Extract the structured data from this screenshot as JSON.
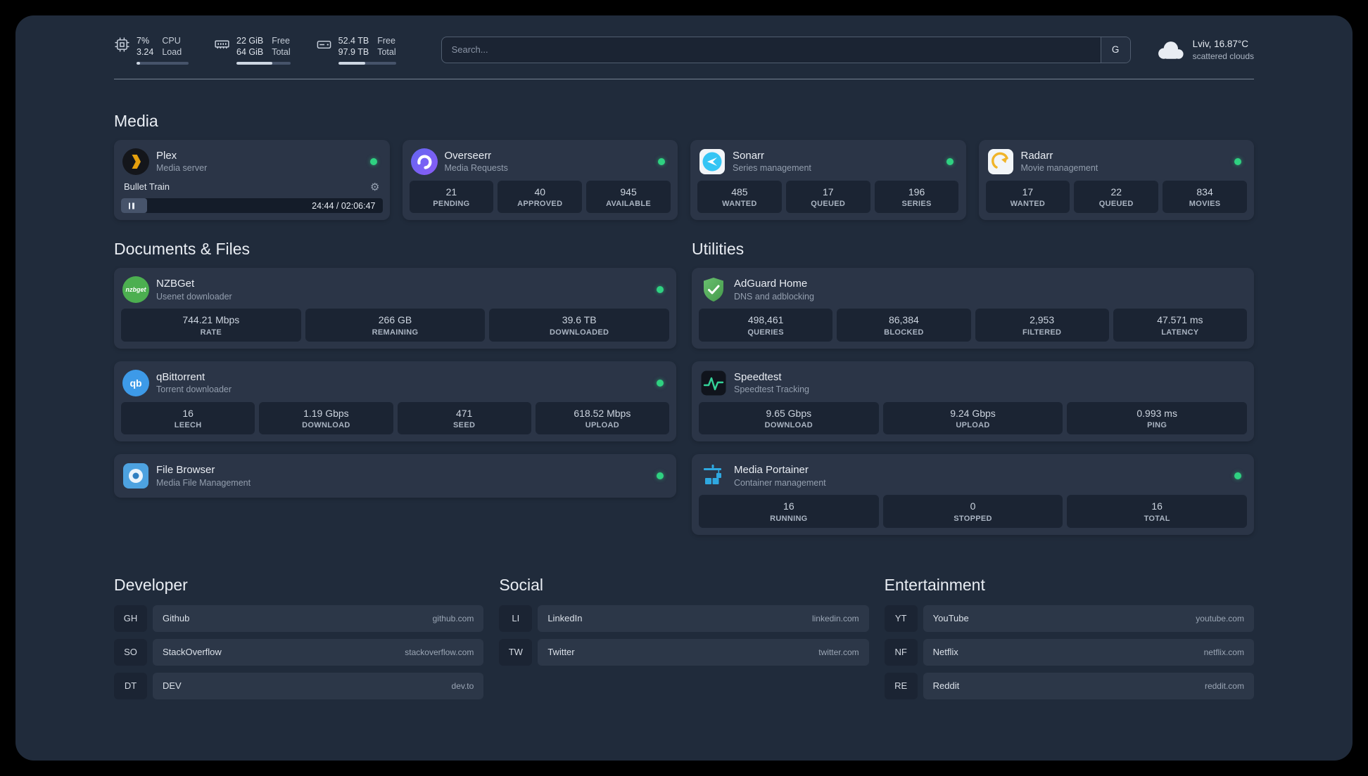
{
  "colors": {
    "status_online": "#2fd181",
    "plex_amber": "#e5a00d",
    "accent_green": "#34d399",
    "portainer_blue": "#2fa8e0"
  },
  "icons": {
    "gear": "⚙"
  },
  "topbar": {
    "cpu": {
      "percent": "7%",
      "load": "3.24",
      "label1": "CPU",
      "label2": "Load",
      "fill": 7
    },
    "memory": {
      "free": "22 GiB",
      "total": "64 GiB",
      "label1": "Free",
      "label2": "Total",
      "fill": 66
    },
    "disk": {
      "free": "52.4 TB",
      "total": "97.9 TB",
      "label1": "Free",
      "label2": "Total",
      "fill": 47
    },
    "search": {
      "placeholder": "Search...",
      "value": "",
      "button": "G"
    },
    "weather": {
      "location": "Lviv, 16.87°C",
      "condition": "scattered clouds"
    }
  },
  "media": {
    "heading": "Media",
    "plex": {
      "name": "Plex",
      "subtitle": "Media server",
      "online": true,
      "now_playing": "Bullet Train",
      "progress_time": "24:44 / 02:06:47",
      "progress_percent": 10
    },
    "overseerr": {
      "name": "Overseerr",
      "subtitle": "Media Requests",
      "online": true,
      "stats": [
        {
          "value": "21",
          "label": "PENDING"
        },
        {
          "value": "40",
          "label": "APPROVED"
        },
        {
          "value": "945",
          "label": "AVAILABLE"
        }
      ]
    },
    "sonarr": {
      "name": "Sonarr",
      "subtitle": "Series management",
      "online": true,
      "stats": [
        {
          "value": "485",
          "label": "WANTED"
        },
        {
          "value": "17",
          "label": "QUEUED"
        },
        {
          "value": "196",
          "label": "SERIES"
        }
      ]
    },
    "radarr": {
      "name": "Radarr",
      "subtitle": "Movie management",
      "online": true,
      "stats": [
        {
          "value": "17",
          "label": "WANTED"
        },
        {
          "value": "22",
          "label": "QUEUED"
        },
        {
          "value": "834",
          "label": "MOVIES"
        }
      ]
    }
  },
  "documents": {
    "heading": "Documents & Files",
    "nzbget": {
      "name": "NZBGet",
      "subtitle": "Usenet downloader",
      "online": true,
      "icon_text": "nzbget",
      "stats": [
        {
          "value": "744.21 Mbps",
          "label": "RATE"
        },
        {
          "value": "266 GB",
          "label": "REMAINING"
        },
        {
          "value": "39.6 TB",
          "label": "DOWNLOADED"
        }
      ]
    },
    "qbittorrent": {
      "name": "qBittorrent",
      "subtitle": "Torrent downloader",
      "online": true,
      "icon_text": "qb",
      "stats": [
        {
          "value": "16",
          "label": "LEECH"
        },
        {
          "value": "1.19 Gbps",
          "label": "DOWNLOAD"
        },
        {
          "value": "471",
          "label": "SEED"
        },
        {
          "value": "618.52 Mbps",
          "label": "UPLOAD"
        }
      ]
    },
    "filebrowser": {
      "name": "File Browser",
      "subtitle": "Media File Management",
      "online": true
    }
  },
  "utilities": {
    "heading": "Utilities",
    "adguard": {
      "name": "AdGuard Home",
      "subtitle": "DNS and adblocking",
      "stats": [
        {
          "value": "498,461",
          "label": "QUERIES"
        },
        {
          "value": "86,384",
          "label": "BLOCKED"
        },
        {
          "value": "2,953",
          "label": "FILTERED"
        },
        {
          "value": "47.571 ms",
          "label": "LATENCY"
        }
      ]
    },
    "speedtest": {
      "name": "Speedtest",
      "subtitle": "Speedtest Tracking",
      "stats": [
        {
          "value": "9.65 Gbps",
          "label": "DOWNLOAD"
        },
        {
          "value": "9.24 Gbps",
          "label": "UPLOAD"
        },
        {
          "value": "0.993 ms",
          "label": "PING"
        }
      ]
    },
    "portainer": {
      "name": "Media Portainer",
      "subtitle": "Container management",
      "online": true,
      "stats": [
        {
          "value": "16",
          "label": "RUNNING"
        },
        {
          "value": "0",
          "label": "STOPPED"
        },
        {
          "value": "16",
          "label": "TOTAL"
        }
      ]
    }
  },
  "bookmarks": {
    "developer": {
      "heading": "Developer",
      "items": [
        {
          "abbr": "GH",
          "name": "Github",
          "url": "github.com"
        },
        {
          "abbr": "SO",
          "name": "StackOverflow",
          "url": "stackoverflow.com"
        },
        {
          "abbr": "DT",
          "name": "DEV",
          "url": "dev.to"
        }
      ]
    },
    "social": {
      "heading": "Social",
      "items": [
        {
          "abbr": "LI",
          "name": "LinkedIn",
          "url": "linkedin.com"
        },
        {
          "abbr": "TW",
          "name": "Twitter",
          "url": "twitter.com"
        }
      ]
    },
    "entertainment": {
      "heading": "Entertainment",
      "items": [
        {
          "abbr": "YT",
          "name": "YouTube",
          "url": "youtube.com"
        },
        {
          "abbr": "NF",
          "name": "Netflix",
          "url": "netflix.com"
        },
        {
          "abbr": "RE",
          "name": "Reddit",
          "url": "reddit.com"
        }
      ]
    }
  }
}
